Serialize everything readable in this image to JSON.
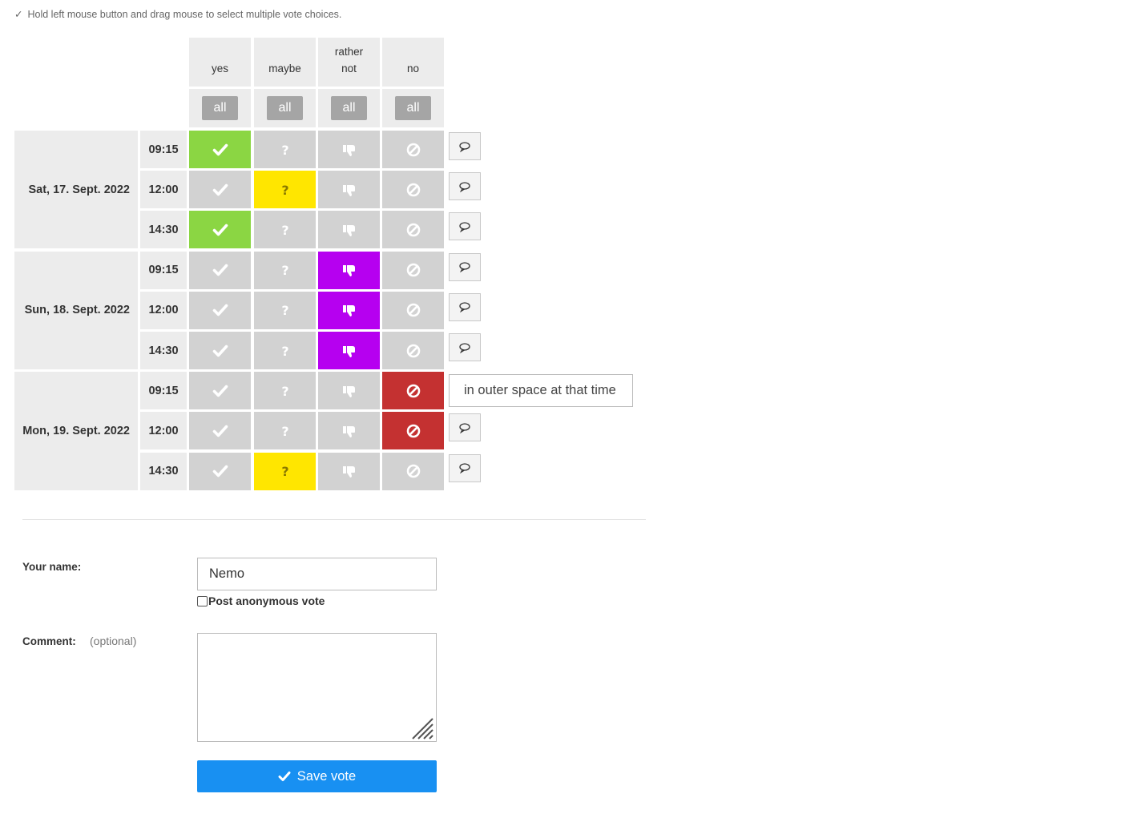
{
  "hint": {
    "tick": "✓",
    "text": "Hold left mouse button and drag mouse to select multiple vote choices."
  },
  "columns": [
    {
      "key": "yes",
      "label": "yes",
      "all": "all"
    },
    {
      "key": "maybe",
      "label": "maybe",
      "all": "all"
    },
    {
      "key": "rather_not",
      "label": "rather not",
      "all": "all"
    },
    {
      "key": "no",
      "label": "no",
      "all": "all"
    }
  ],
  "colors": {
    "yes": "#8bd643",
    "maybe": "#ffe600",
    "rather_not": "#b600f0",
    "no": "#c43131",
    "inactive": "#d2d2d2"
  },
  "days": [
    {
      "label": "Sat, 17. Sept. 2022",
      "slots": [
        {
          "time": "09:15",
          "vote": "yes"
        },
        {
          "time": "12:00",
          "vote": "maybe"
        },
        {
          "time": "14:30",
          "vote": "yes"
        }
      ]
    },
    {
      "label": "Sun, 18. Sept. 2022",
      "slots": [
        {
          "time": "09:15",
          "vote": "rather_not"
        },
        {
          "time": "12:00",
          "vote": "rather_not"
        },
        {
          "time": "14:30",
          "vote": "rather_not"
        }
      ]
    },
    {
      "label": "Mon, 19. Sept. 2022",
      "slots": [
        {
          "time": "09:15",
          "vote": "no",
          "comment": "in outer space at that time"
        },
        {
          "time": "12:00",
          "vote": "no"
        },
        {
          "time": "14:30",
          "vote": "maybe"
        }
      ]
    }
  ],
  "form": {
    "name_label": "Your name:",
    "name_value": "Nemo",
    "anonymous_label": "Post anonymous vote",
    "anonymous_checked": false,
    "comment_label": "Comment:",
    "comment_optional": "(optional)",
    "comment_value": "",
    "save_label": "Save vote"
  }
}
